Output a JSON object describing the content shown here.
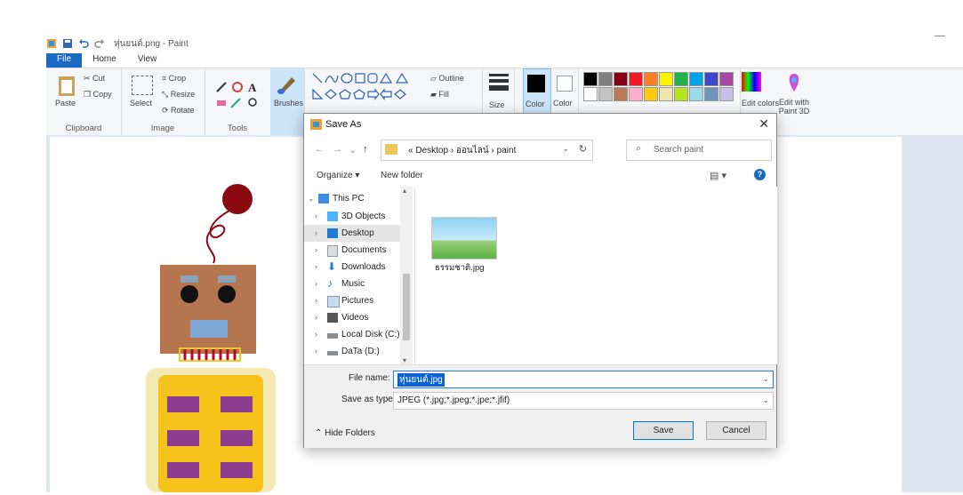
{
  "window": {
    "title": "หุ่นยนต์.png - Paint"
  },
  "ribbon": {
    "tabs": [
      "File",
      "Home",
      "View"
    ],
    "clipboard": {
      "label": "Clipboard",
      "paste": "Paste",
      "cut": "Cut",
      "copy": "Copy"
    },
    "image": {
      "label": "Image",
      "select": "Select",
      "crop": "Crop",
      "resize": "Resize",
      "rotate": "Rotate"
    },
    "tools": {
      "label": "Tools"
    },
    "brushes": {
      "label": "Brushes"
    },
    "shapes": {
      "outline": "Outline",
      "fill": "Fill"
    },
    "size": {
      "label": "Size"
    },
    "color1": {
      "label": "Color"
    },
    "color2": {
      "label": "Color"
    },
    "palette": [
      "#000000",
      "#7f7f7f",
      "#880015",
      "#ed1c24",
      "#ff7f27",
      "#fff200",
      "#22b14c",
      "#00a2e8",
      "#3f48cc",
      "#a349a4",
      "#ffffff",
      "#c3c3c3",
      "#b97a57",
      "#ffaec9",
      "#ffc90e",
      "#efe4b0",
      "#b5e61d",
      "#99d9ea",
      "#7092be",
      "#c8bfe7"
    ],
    "edit_colors": "Edit colors",
    "edit_3d": "Edit with Paint 3D"
  },
  "dialog": {
    "title": "Save As",
    "breadcrumb": [
      "Desktop",
      "ออนไลน์",
      "paint"
    ],
    "search_placeholder": "Search paint",
    "organize": "Organize",
    "new_folder": "New folder",
    "nav_items": [
      {
        "label": "This PC",
        "icon": "pc-icon"
      },
      {
        "label": "3D Objects",
        "icon": "3d-objects-icon"
      },
      {
        "label": "Desktop",
        "icon": "desktop-icon"
      },
      {
        "label": "Documents",
        "icon": "documents-icon"
      },
      {
        "label": "Downloads",
        "icon": "downloads-icon"
      },
      {
        "label": "Music",
        "icon": "music-icon"
      },
      {
        "label": "Pictures",
        "icon": "pictures-icon"
      },
      {
        "label": "Videos",
        "icon": "videos-icon"
      },
      {
        "label": "Local Disk (C:)",
        "icon": "local-disk-icon"
      },
      {
        "label": "DaTa (D:)",
        "icon": "drive-icon"
      }
    ],
    "files": [
      {
        "name": "ธรรมชาติ.jpg"
      }
    ],
    "file_name_label": "File name:",
    "file_name_value": "หุ่นยนต์.jpg",
    "save_type_label": "Save as type:",
    "save_type_value": "JPEG (*.jpg;*.jpeg;*.jpe;*.jfif)",
    "hide_folders": "Hide Folders",
    "save": "Save",
    "cancel": "Cancel"
  }
}
